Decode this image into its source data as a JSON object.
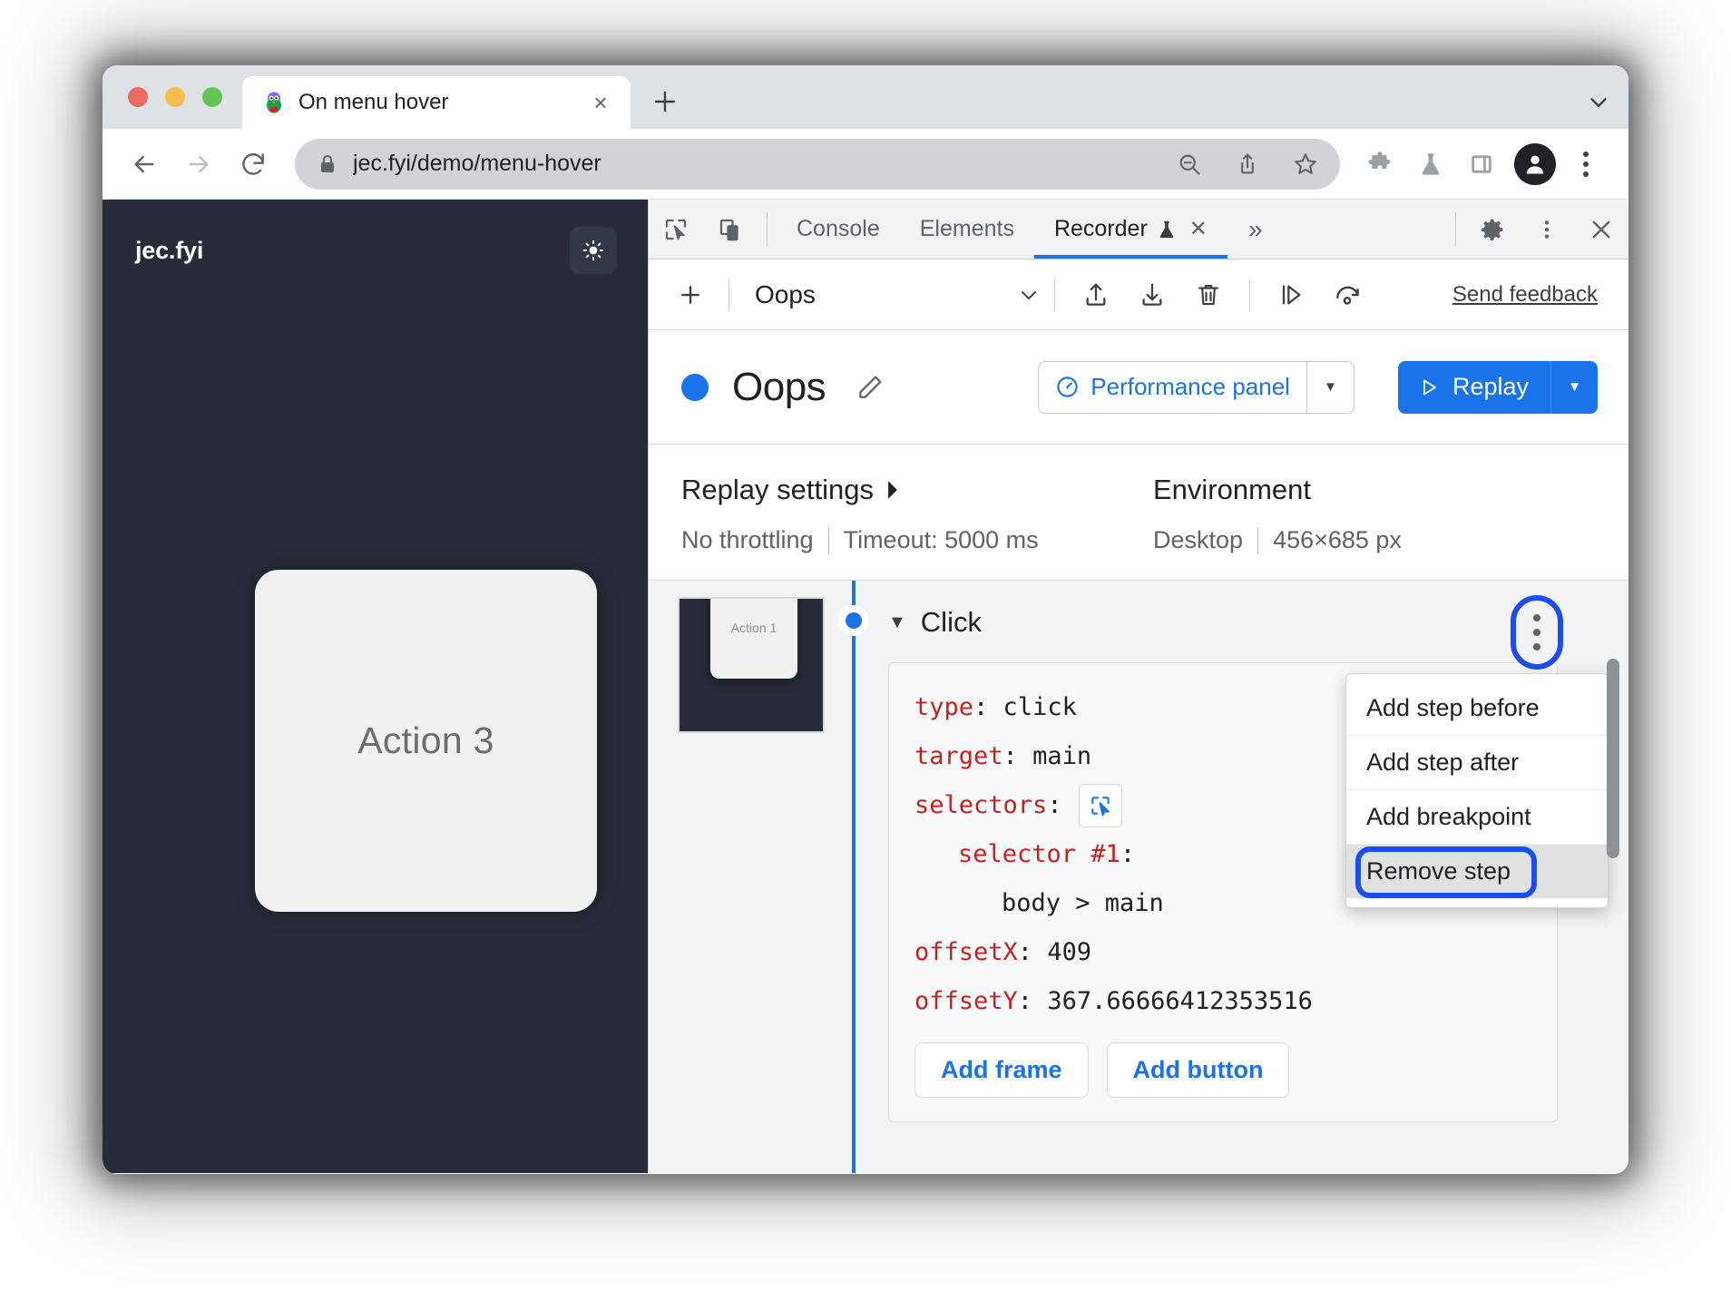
{
  "browser": {
    "tab": {
      "title": "On menu hover",
      "favicon": "penguin-favicon",
      "close_label": "×"
    },
    "new_tab_label": "+",
    "omnibox": {
      "url": "jec.fyi/demo/menu-hover",
      "lock": "lock-icon"
    },
    "toolbar_icons": [
      "back-arrow",
      "forward-arrow",
      "reload",
      "zoom-out",
      "share",
      "bookmark-star",
      "extensions-puzzle",
      "flask",
      "side-panel",
      "profile",
      "chrome-menu"
    ]
  },
  "page": {
    "site_logo": "jec.fyi",
    "theme_toggle": "sun-icon",
    "card_label": "Action 3"
  },
  "devtools": {
    "tabs": [
      {
        "label": "Console",
        "active": false
      },
      {
        "label": "Elements",
        "active": false
      },
      {
        "label": "Recorder",
        "active": true,
        "experiment": true,
        "closable": true
      }
    ],
    "overflow_label": "»",
    "recorder": {
      "toolbar": {
        "add_label": "+",
        "selected_recording": "Oops",
        "send_feedback": "Send feedback",
        "icons": [
          "export-icon",
          "import-icon",
          "delete-icon",
          "step-over-icon",
          "replay-slow-icon"
        ]
      },
      "title": "Oops",
      "performance_button": "Performance panel",
      "replay_button": "Replay",
      "replay_settings": {
        "heading": "Replay settings",
        "throttling": "No throttling",
        "timeout": "Timeout: 5000 ms"
      },
      "environment": {
        "heading": "Environment",
        "device": "Desktop",
        "viewport": "456×685 px"
      },
      "thumbnail_label": "Action 1",
      "step": {
        "title": "Click",
        "lines": [
          {
            "key": "type",
            "value": "click",
            "indent": 0
          },
          {
            "key": "target",
            "value": "main",
            "indent": 0
          },
          {
            "key": "selectors",
            "value": "",
            "indent": 0,
            "picker": true
          },
          {
            "key": "selector #1",
            "value": "",
            "indent": 1
          },
          {
            "key": "",
            "value": "body > main",
            "indent": 2
          },
          {
            "key": "offsetX",
            "value": "409",
            "indent": 0
          },
          {
            "key": "offsetY",
            "value": "367.66666412353516",
            "indent": 0
          }
        ],
        "add_frame_label": "Add frame",
        "add_button_label": "Add button"
      },
      "context_menu": [
        {
          "label": "Add step before",
          "highlighted": false
        },
        {
          "label": "Add step after",
          "highlighted": false
        },
        {
          "label": "Add breakpoint",
          "highlighted": false
        },
        {
          "label": "Remove step",
          "highlighted": true
        }
      ]
    }
  },
  "colors": {
    "accent_blue": "#1a73e8",
    "highlight_ring": "#1b4df0",
    "code_key_red": "#c5221f",
    "page_dark": "#272c38"
  }
}
